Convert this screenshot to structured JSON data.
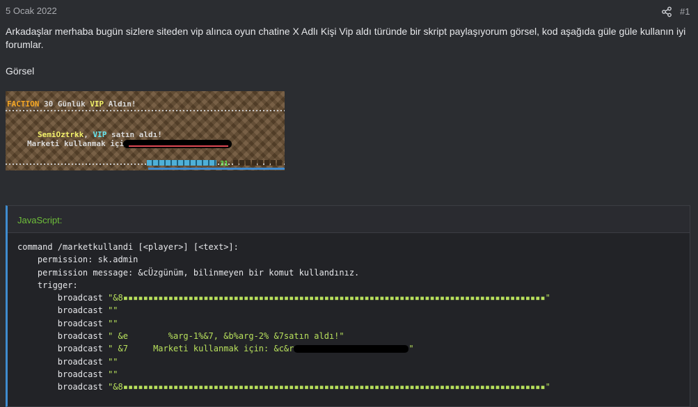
{
  "post": {
    "date": "5 Ocak 2022",
    "number": "#1",
    "share_icon": "share-icon",
    "body": "Arkadaşlar merhaba bugün sizlere siteden vip alınca oyun chatine X Adlı Kişi Vip aldı türünde bir skript paylaşıyorum görsel, kod aşağıda güle güle kullanın iyi forumlar.",
    "image_label": "Görsel"
  },
  "screenshot": {
    "prefix": "FACTION",
    "announce_a": "30 Günlük ",
    "announce_vip": "VIP",
    "announce_b": " Aldın!",
    "buyer_name": "SemiOztrkk",
    "buyer_vip": "VIP",
    "buyer_rest": " satın aldı!",
    "market_text": "Marketi kullanmak için:",
    "level": "31"
  },
  "code": {
    "language": "JavaScript:",
    "lines": [
      "command /marketkullandi [<player>] [<text>]:",
      "    permission: sk.admin",
      "    permission message: &cÜzgünüm, bilinmeyen bir komut kullandınız.",
      "    trigger:"
    ],
    "cmd": "broadcast",
    "indent": "        ",
    "broadcast_args": [
      "\"&8▪▪▪▪▪▪▪▪▪▪▪▪▪▪▪▪▪▪▪▪▪▪▪▪▪▪▪▪▪▪▪▪▪▪▪▪▪▪▪▪▪▪▪▪▪▪▪▪▪▪▪▪▪▪▪▪▪▪▪▪▪▪▪▪▪▪▪▪▪▪▪▪▪▪▪▪▪▪▪▪▪▪▪▪\"",
      "\"\"",
      "\"\"",
      "\" &e        %arg-1%&7, &b%arg-2% &7satın aldı!\"",
      "\" &7     Marketi kullanmak için: &c&r",
      "\"\"",
      "\"\"",
      "\"&8▪▪▪▪▪▪▪▪▪▪▪▪▪▪▪▪▪▪▪▪▪▪▪▪▪▪▪▪▪▪▪▪▪▪▪▪▪▪▪▪▪▪▪▪▪▪▪▪▪▪▪▪▪▪▪▪▪▪▪▪▪▪▪▪▪▪▪▪▪▪▪▪▪▪▪▪▪▪▪▪▪▪▪▪\""
    ],
    "redacted_tail": "\""
  }
}
